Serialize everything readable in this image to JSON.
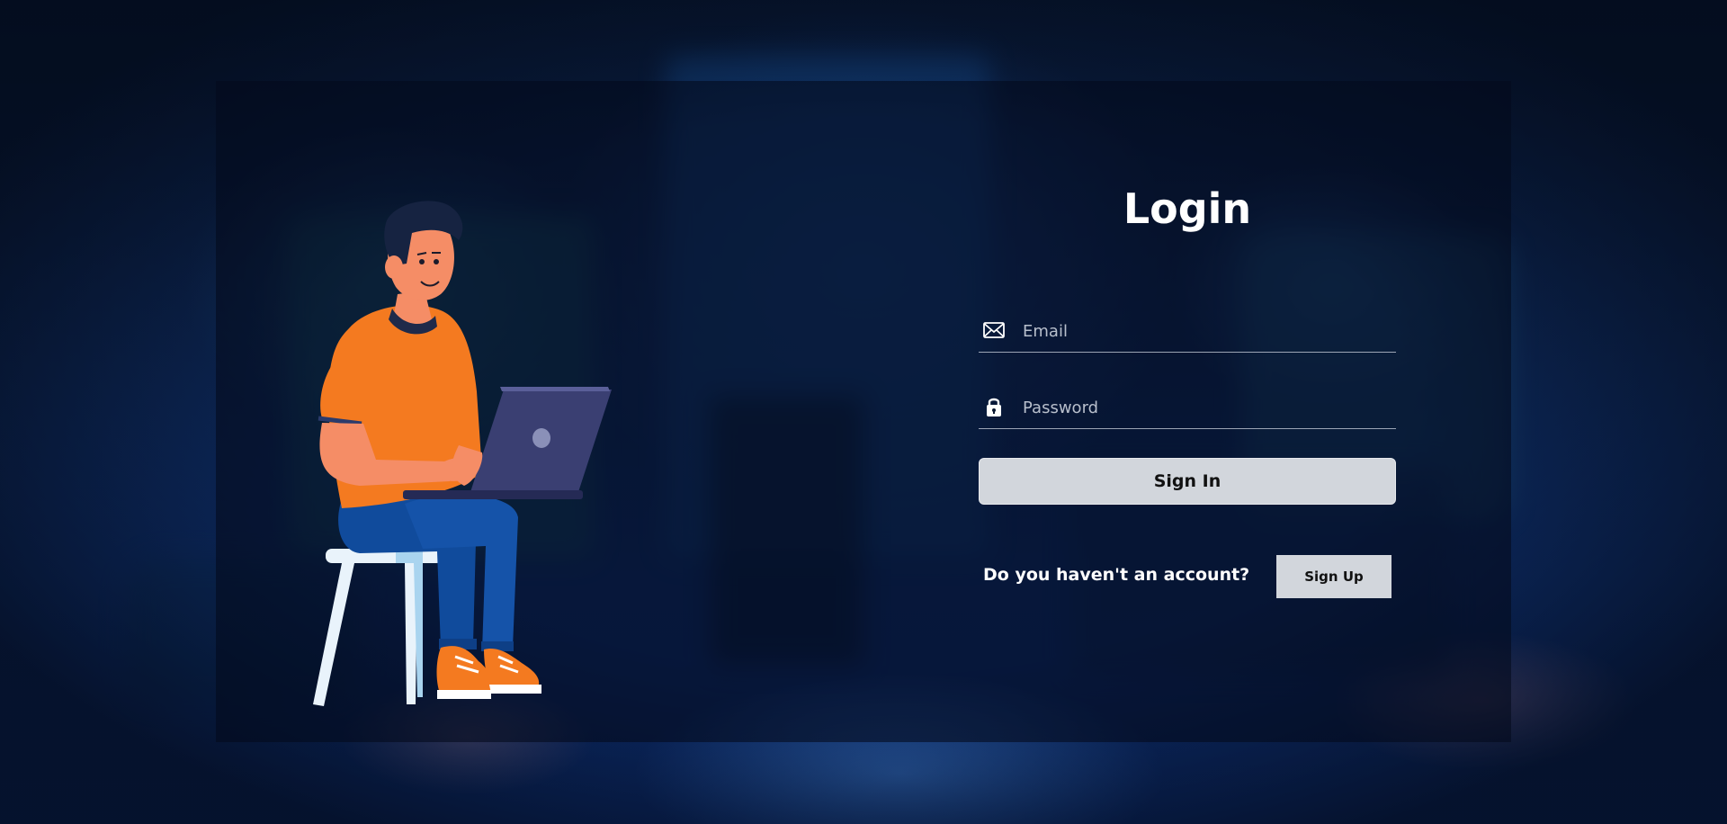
{
  "login": {
    "title": "Login",
    "email": {
      "placeholder": "Email",
      "icon": "envelope-icon"
    },
    "password": {
      "placeholder": "Password",
      "icon": "lock-icon"
    },
    "signin_label": "Sign In",
    "signup_prompt": "Do you haven't an account?",
    "signup_label": "Sign Up"
  },
  "illustration": {
    "subject": "person-with-laptop-illustration"
  },
  "colors": {
    "accent_orange": "#f47a20",
    "button_bg": "#d2d6dc",
    "panel_bg": "#030a1c",
    "text": "#ffffff"
  }
}
